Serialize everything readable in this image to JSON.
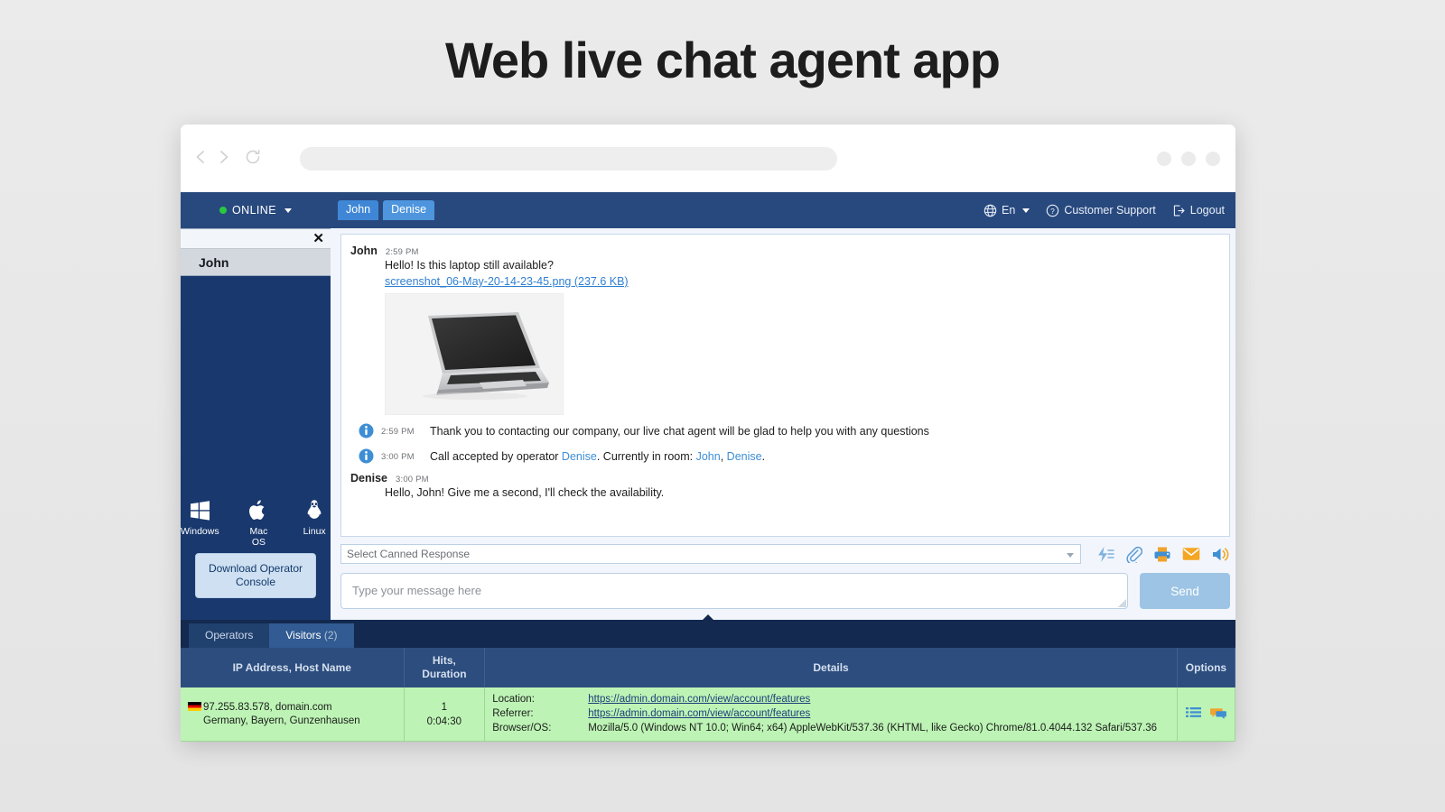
{
  "page": {
    "title": "Web live chat agent app"
  },
  "browser": {
    "back_icon": "chevron-left-icon",
    "forward_icon": "chevron-right-icon",
    "reload_icon": "reload-icon",
    "url_value": "",
    "url_placeholder": ""
  },
  "app": {
    "status": {
      "label": "ONLINE",
      "dot_color": "#28c840"
    },
    "room_tabs": [
      {
        "label": "John",
        "active": true
      },
      {
        "label": "Denise",
        "active": false
      }
    ],
    "topbar_right": [
      {
        "icon": "globe-icon",
        "label": "En"
      },
      {
        "icon": "question-circle-icon",
        "label": "Customer Support"
      },
      {
        "icon": "logout-icon",
        "label": "Logout"
      }
    ]
  },
  "sidebar": {
    "close_label": "✕",
    "visitor_items": [
      {
        "label": "John"
      }
    ],
    "os_links": [
      {
        "icon": "windows-icon",
        "label": "Windows"
      },
      {
        "icon": "apple-icon",
        "label": "Mac OS"
      },
      {
        "icon": "linux-icon",
        "label": "Linux"
      }
    ],
    "download_button": "Download Operator Console"
  },
  "chat": {
    "messages": [
      {
        "type": "user",
        "author": "John",
        "time": "2:59 PM",
        "text": "Hello! Is this laptop still available?",
        "attachment": "screenshot_06-May-20-14-23-45.png (237.6 KB)",
        "thumbnail": "laptop-photo"
      },
      {
        "type": "system",
        "icon": "info-icon",
        "time": "2:59 PM",
        "text": "Thank you to contacting our company, our live chat agent will be glad to help you with any questions"
      },
      {
        "type": "system_call",
        "icon": "info-icon",
        "time": "3:00 PM",
        "prefix": "Call accepted by operator ",
        "operator": "Denise",
        "mid": ". Currently in room: ",
        "room_user_1": "John",
        "sep": ", ",
        "room_user_2": "Denise",
        "suffix": "."
      },
      {
        "type": "agent",
        "author": "Denise",
        "time": "3:00 PM",
        "text": "Hello, John! Give me a second, I'll check the availability."
      }
    ],
    "canned_response_placeholder": "Select Canned Response",
    "toolbar_icons": [
      "quick-response-icon",
      "attachment-icon",
      "print-icon",
      "email-icon",
      "sound-icon"
    ],
    "compose_placeholder": "Type your message here",
    "send_label": "Send"
  },
  "bottom": {
    "tabs": [
      {
        "label": "Operators",
        "count": "",
        "active": false
      },
      {
        "label": "Visitors ",
        "count": "(2)",
        "active": true
      }
    ],
    "columns": [
      "IP Address, Host Name",
      "Hits, Duration",
      "Details",
      "Options"
    ],
    "col_hits_line1": "Hits,",
    "col_hits_line2": "Duration",
    "rows": [
      {
        "flag": "germany-flag-icon",
        "ip": "97.255.83.578, domain.com",
        "geo": "Germany, Bayern, Gunzenhausen",
        "hits": "1",
        "duration": "0:04:30",
        "details": [
          {
            "label": "Location:",
            "value": "https://admin.domain.com/view/account/features",
            "is_link": true
          },
          {
            "label": "Referrer:",
            "value": "https://admin.domain.com/view/account/features",
            "is_link": true
          },
          {
            "label": "Browser/OS:",
            "value": "Mozilla/5.0 (Windows NT 10.0; Win64; x64) AppleWebKit/537.36 (KHTML, like Gecko) Chrome/81.0.4044.132 Safari/537.36",
            "is_link": false
          }
        ],
        "options_icons": [
          "list-icon",
          "chat-icon"
        ]
      }
    ]
  },
  "colors": {
    "brand_dark": "#19386d",
    "brand_header": "#28497e",
    "tab_blue": "#3f87d6",
    "panel_dark": "#13294f",
    "row_green": "#bdf4b5",
    "link_blue": "#3e8ed5"
  }
}
